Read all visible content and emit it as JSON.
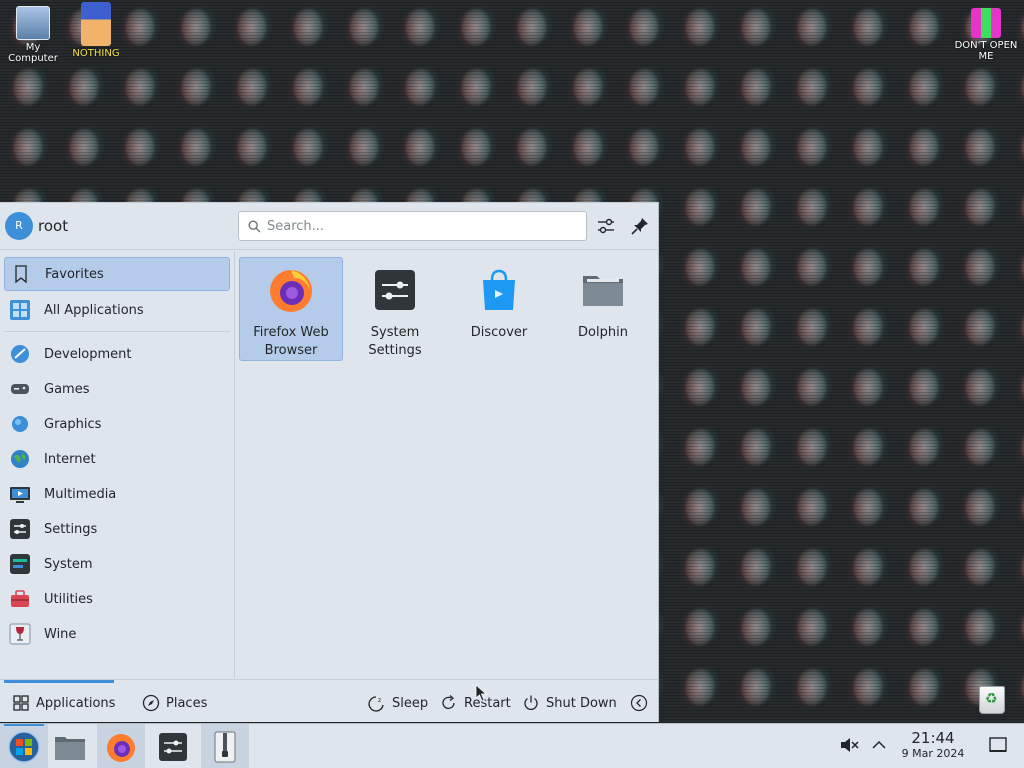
{
  "desktop": {
    "icons": [
      {
        "label": "My Computer"
      },
      {
        "label": "NOTHING"
      },
      {
        "label": "DON'T OPEN ME"
      }
    ]
  },
  "launcher": {
    "user": {
      "initial": "R",
      "name": "root"
    },
    "search": {
      "placeholder": "Search..."
    },
    "categories": [
      {
        "label": "Favorites",
        "icon": "bookmark-icon",
        "selected": true
      },
      {
        "label": "All Applications",
        "icon": "grid-icon"
      },
      {
        "label": "Development",
        "icon": "development-icon"
      },
      {
        "label": "Games",
        "icon": "gamepad-icon"
      },
      {
        "label": "Graphics",
        "icon": "graphics-icon"
      },
      {
        "label": "Internet",
        "icon": "globe-icon"
      },
      {
        "label": "Multimedia",
        "icon": "multimedia-icon"
      },
      {
        "label": "Settings",
        "icon": "settings-icon"
      },
      {
        "label": "System",
        "icon": "system-icon"
      },
      {
        "label": "Utilities",
        "icon": "toolbox-icon"
      },
      {
        "label": "Wine",
        "icon": "wine-icon"
      }
    ],
    "favorites": [
      {
        "label": "Firefox Web Browser",
        "icon": "firefox-icon",
        "selected": true
      },
      {
        "label": "System Settings",
        "icon": "system-settings-icon"
      },
      {
        "label": "Discover",
        "icon": "discover-icon"
      },
      {
        "label": "Dolphin",
        "icon": "folder-icon"
      }
    ],
    "footer": {
      "applications": "Applications",
      "places": "Places",
      "sleep": "Sleep",
      "restart": "Restart",
      "shutdown": "Shut Down"
    }
  },
  "taskbar": {
    "clock": {
      "time": "21:44",
      "date": "9 Mar 2024"
    }
  },
  "colors": {
    "accent": "#3d8fd8",
    "panel": "#dfe5ec",
    "selection": "#b5cbea"
  }
}
